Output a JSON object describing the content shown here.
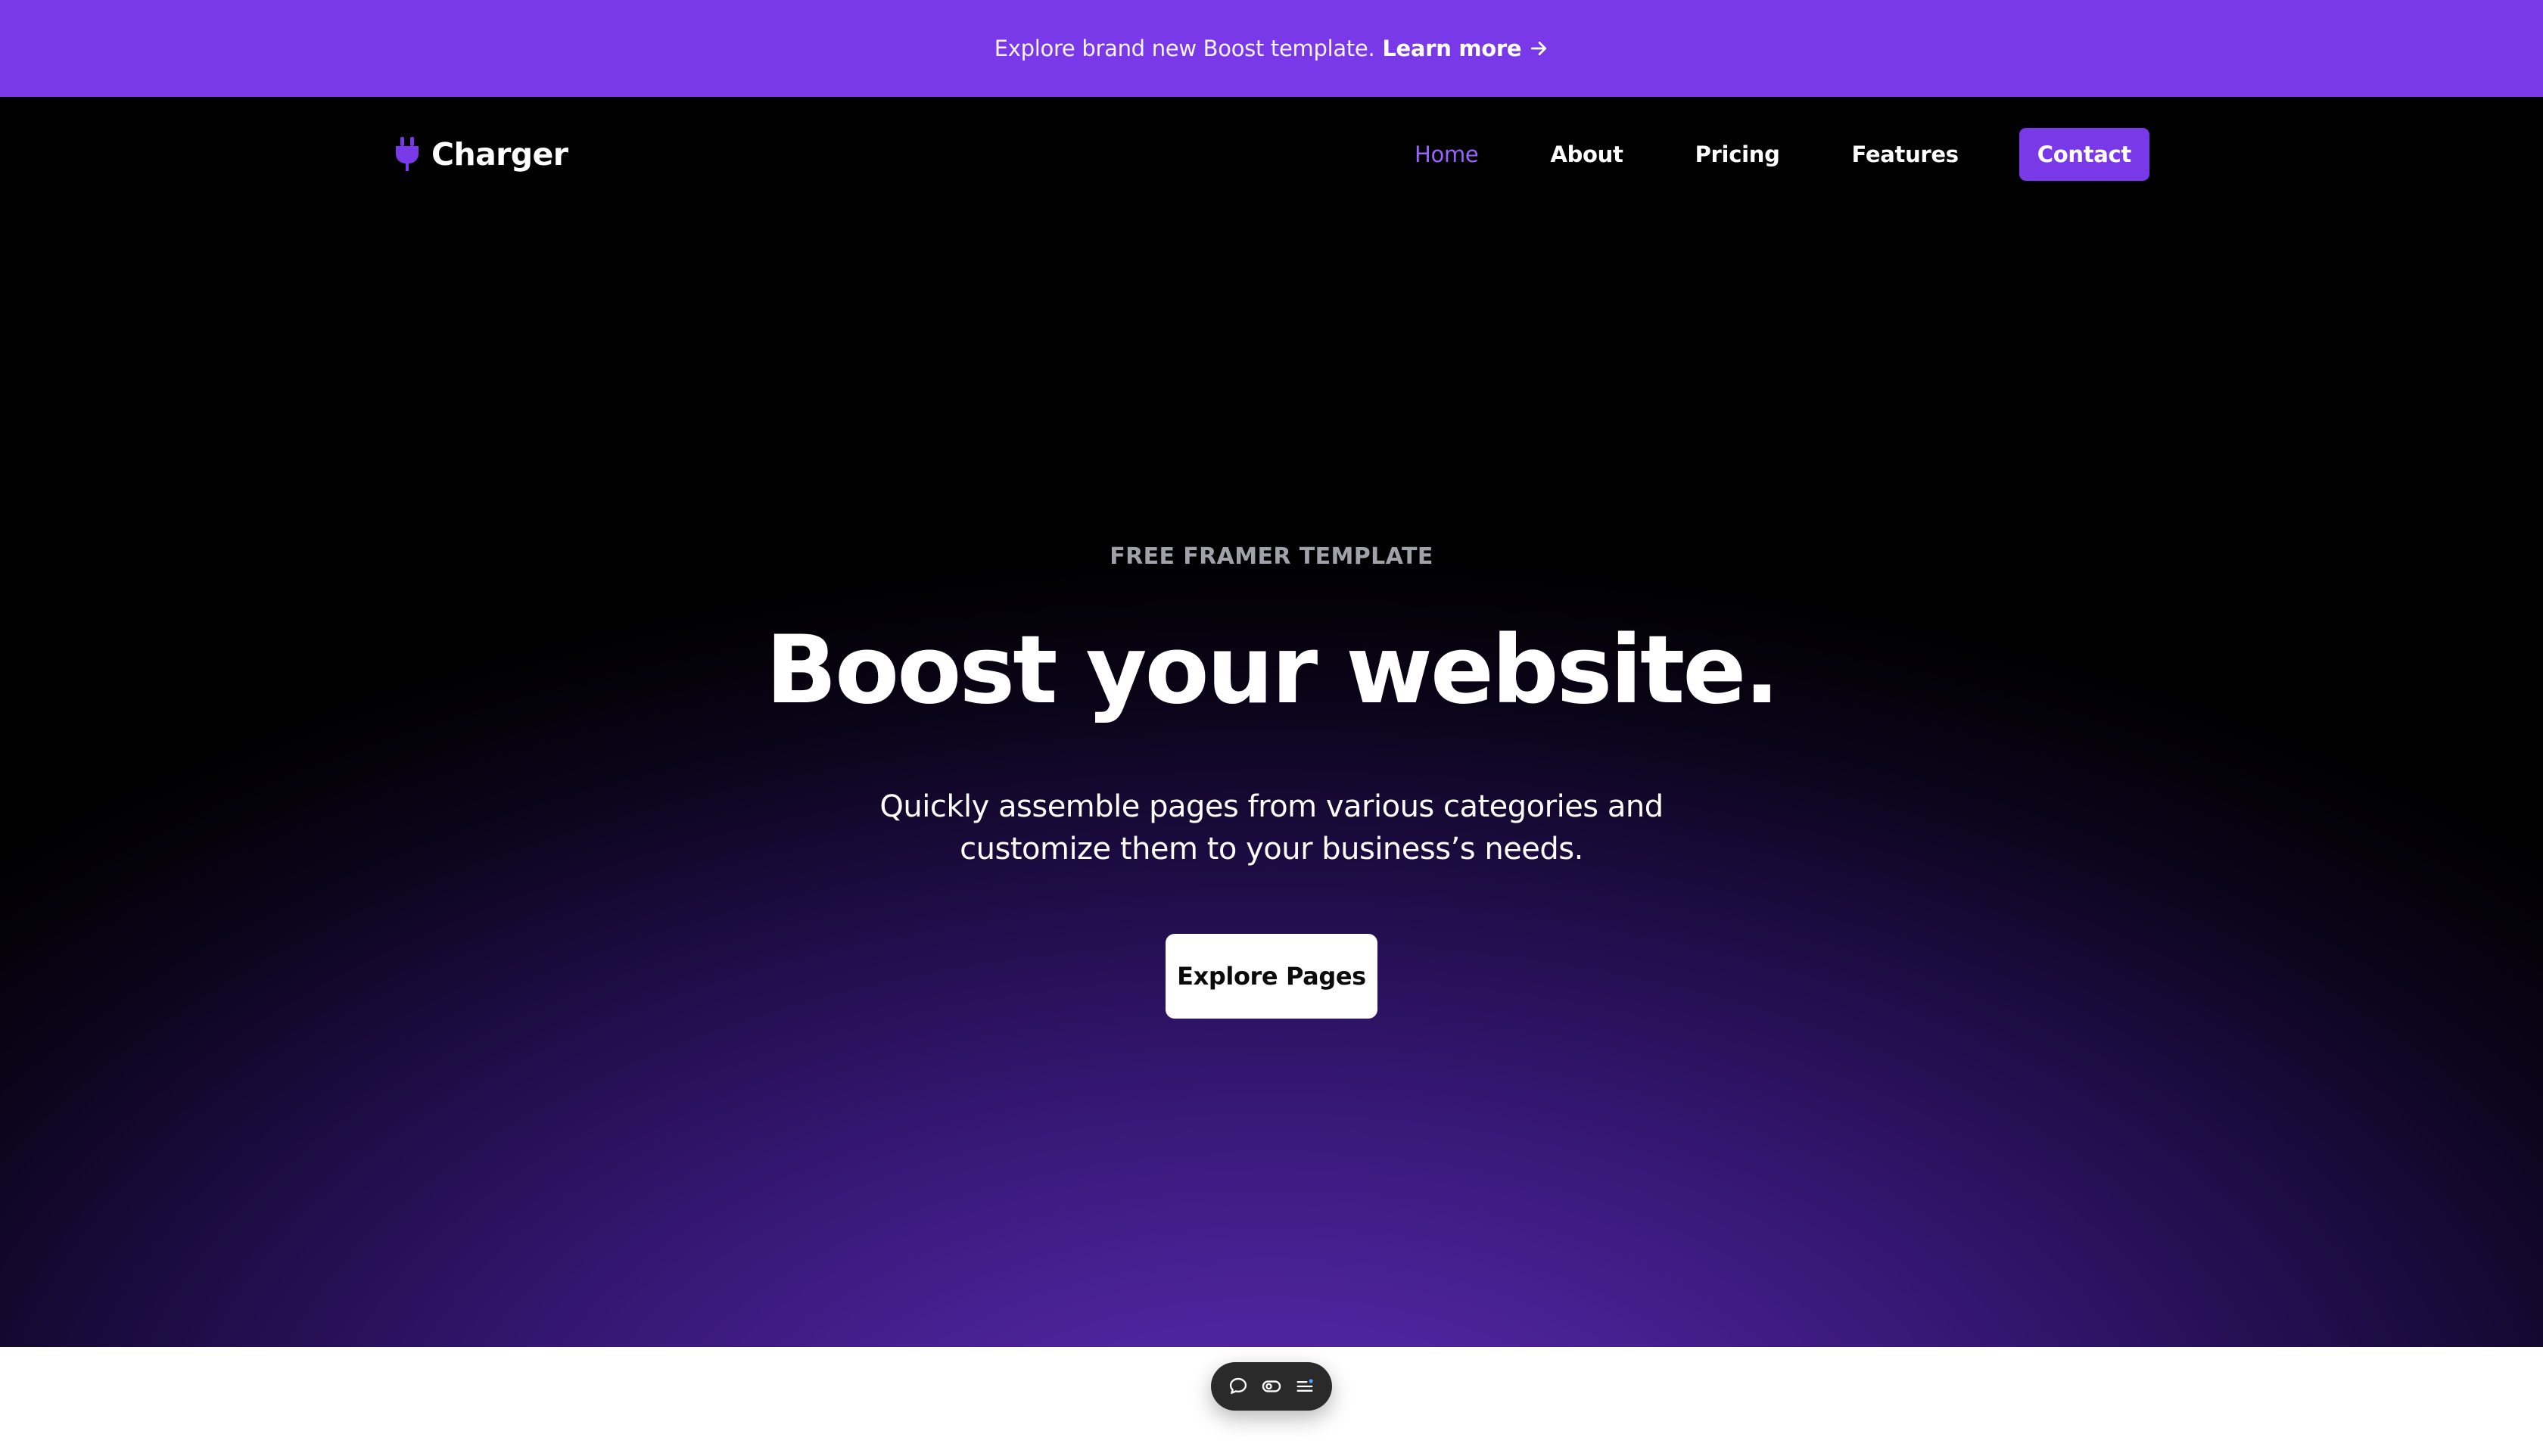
{
  "promo": {
    "text": "Explore brand new Boost template.",
    "link_label": "Learn more",
    "link_icon": "arrow-right-icon"
  },
  "nav": {
    "brand": "Charger",
    "brand_icon": "plug-icon",
    "items": [
      {
        "label": "Home",
        "active": true
      },
      {
        "label": "About",
        "active": false
      },
      {
        "label": "Pricing",
        "active": false
      },
      {
        "label": "Features",
        "active": false
      }
    ],
    "cta_label": "Contact"
  },
  "hero": {
    "eyebrow": "FREE FRAMER TEMPLATE",
    "headline": "Boost your website.",
    "subtext": "Quickly assemble pages from various categories and customize them to your business’s needs.",
    "cta_label": "Explore Pages"
  },
  "toolbar": {
    "icons": [
      "comment-icon",
      "preview-toggle-icon",
      "list-settings-icon"
    ]
  },
  "colors": {
    "accent": "#7a39e8",
    "active_link": "#9a63ff",
    "eyebrow": "#a1a1aa",
    "hero_background": "#000000",
    "hero_glow": "#5b2bb3"
  }
}
